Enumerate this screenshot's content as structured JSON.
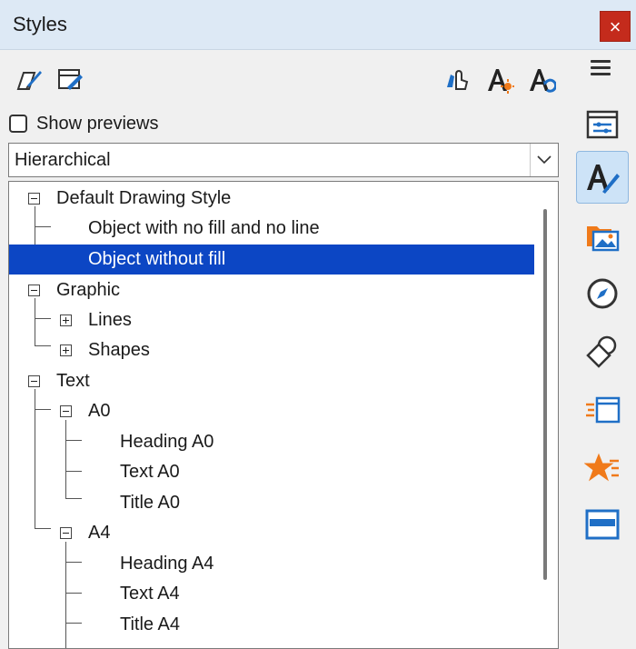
{
  "window": {
    "title": "Styles",
    "close_glyph": "×"
  },
  "toolbar": {
    "left_icons": [
      "new-style-from-selection-icon",
      "update-style-icon"
    ],
    "right_icons": [
      "fill-format-mode-icon",
      "new-style-icon",
      "update-style-icon"
    ]
  },
  "show_previews": {
    "label": "Show previews",
    "checked": false
  },
  "filter": {
    "selected": "Hierarchical"
  },
  "tree": {
    "rows": [
      {
        "label": "Default Drawing Style",
        "level": 0,
        "expander": "minus"
      },
      {
        "label": "Object with no fill and no line",
        "level": 1,
        "expander": "none"
      },
      {
        "label": "Object without fill",
        "level": 1,
        "expander": "none",
        "selected": true
      },
      {
        "label": "Graphic",
        "level": 0,
        "expander": "minus"
      },
      {
        "label": "Lines",
        "level": 1,
        "expander": "plus"
      },
      {
        "label": "Shapes",
        "level": 1,
        "expander": "plus"
      },
      {
        "label": "Text",
        "level": 0,
        "expander": "minus"
      },
      {
        "label": "A0",
        "level": 1,
        "expander": "minus"
      },
      {
        "label": "Heading A0",
        "level": 2,
        "expander": "none"
      },
      {
        "label": "Text A0",
        "level": 2,
        "expander": "none"
      },
      {
        "label": "Title A0",
        "level": 2,
        "expander": "none"
      },
      {
        "label": "A4",
        "level": 1,
        "expander": "minus"
      },
      {
        "label": "Heading A4",
        "level": 2,
        "expander": "none"
      },
      {
        "label": "Text A4",
        "level": 2,
        "expander": "none"
      },
      {
        "label": "Title A4",
        "level": 2,
        "expander": "none"
      }
    ]
  },
  "sidebar": {
    "menu_icon": "hamburger-menu-icon",
    "items": [
      {
        "name": "properties-icon",
        "active": false
      },
      {
        "name": "styles-icon",
        "active": true
      },
      {
        "name": "gallery-icon",
        "active": false
      },
      {
        "name": "navigator-icon",
        "active": false
      },
      {
        "name": "shapes-icon",
        "active": false
      },
      {
        "name": "slide-transition-icon",
        "active": false
      },
      {
        "name": "animation-icon",
        "active": false
      },
      {
        "name": "master-slides-icon",
        "active": false
      }
    ]
  },
  "colors": {
    "selection": "#0c46c4",
    "titlebar": "#dde9f5",
    "close": "#c42b1c",
    "accent_blue": "#1f6fc6",
    "accent_orange": "#f07a1a"
  }
}
